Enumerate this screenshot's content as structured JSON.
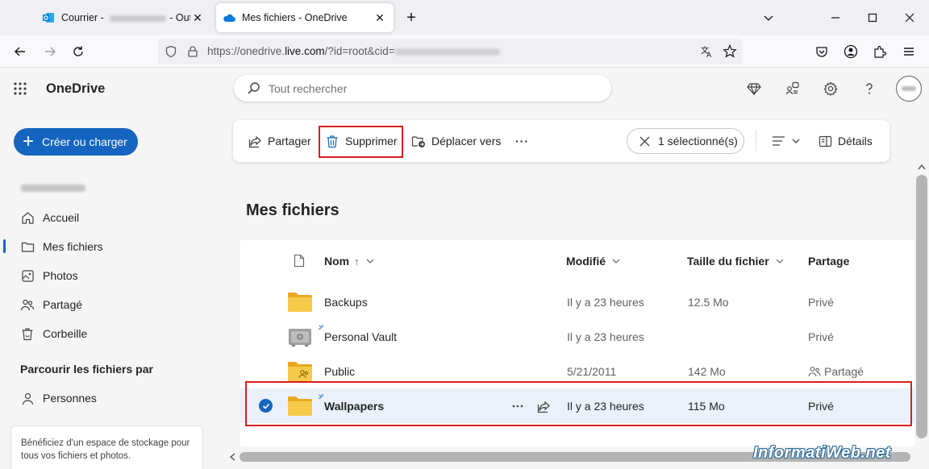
{
  "browser": {
    "tabs": [
      {
        "title_prefix": "Courrier - ",
        "title_suffix": "- Outlook"
      },
      {
        "title": "Mes fichiers - OneDrive"
      }
    ],
    "url_prefix": "https://onedrive.",
    "url_domain": "live.com",
    "url_suffix": "/?id=root&cid="
  },
  "app": {
    "brand": "OneDrive",
    "search_placeholder": "Tout rechercher"
  },
  "sidebar": {
    "create_label": "Créer ou charger",
    "items": [
      {
        "label": "Accueil",
        "icon": "home-icon"
      },
      {
        "label": "Mes fichiers",
        "icon": "folder-icon"
      },
      {
        "label": "Photos",
        "icon": "image-icon"
      },
      {
        "label": "Partagé",
        "icon": "people-icon"
      },
      {
        "label": "Corbeille",
        "icon": "trash-icon"
      }
    ],
    "browse_heading": "Parcourir les fichiers par",
    "people_label": "Personnes",
    "promo_text": "Bénéficiez d'un espace de stockage pour tous vos fichiers et photos."
  },
  "commands": {
    "share": "Partager",
    "delete": "Supprimer",
    "move": "Déplacer vers",
    "more": "···",
    "selection": "1 sélectionné(s)",
    "details": "Détails"
  },
  "main": {
    "title": "Mes fichiers",
    "columns": {
      "name": "Nom",
      "name_sort": "↑",
      "modified": "Modifié",
      "size": "Taille du fichier",
      "sharing": "Partage"
    },
    "files": [
      {
        "name": "Backups",
        "modified": "Il y a 23 heures",
        "size": "12.5 Mo",
        "sharing": "Privé"
      },
      {
        "name": "Personal Vault",
        "modified": "Il y a 23 heures",
        "size": "",
        "sharing": "Privé"
      },
      {
        "name": "Public",
        "modified": "5/21/2011",
        "size": "142 Mo",
        "sharing": "Partagé"
      },
      {
        "name": "Wallpapers",
        "modified": "Il y a 23 heures",
        "size": "115 Mo",
        "sharing": "Privé",
        "selected": true
      }
    ]
  },
  "watermark": "InformatiWeb.net",
  "colors": {
    "accent": "#1565c0",
    "highlight_box": "#d81e1e",
    "folder": "#f7c94a",
    "selected_row": "#eaf1fb"
  }
}
